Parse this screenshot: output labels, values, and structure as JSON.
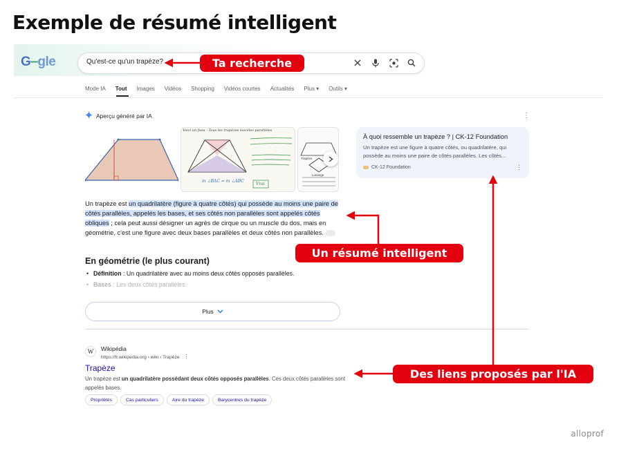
{
  "page_title": "Exemple de résumé intelligent",
  "google": {
    "logo_letters": [
      "G",
      "‒",
      "gle"
    ],
    "search_value": "Qu'est-ce qu'un trapèze?",
    "tabs": [
      {
        "label": "Mode IA"
      },
      {
        "label": "Tout"
      },
      {
        "label": "Images"
      },
      {
        "label": "Vidéos"
      },
      {
        "label": "Shopping"
      },
      {
        "label": "Vidéos courtes"
      },
      {
        "label": "Actualités"
      },
      {
        "label": "Plus"
      },
      {
        "label": "Outils"
      }
    ],
    "active_tab": "Tout"
  },
  "ai_overview": {
    "header": "Aperçu généré par IA",
    "image_texts": {
      "handwritten_line": "Voici un fusu : Tous les trapèzes isocèles parallèles",
      "formula": "m ∠BAC = m ∠ABC",
      "vrai": "Vrai",
      "diagram_label_1": "Trapèze",
      "diagram_label_2": "Losange"
    },
    "summary_intro": "Un trapèze est ",
    "summary_highlight": "un quadrilatère (figure à quatre côtés) qui possède au moins une paire de côtés parallèles, appelés les bases, et ses côtés non parallèles sont appelés côtés obliques",
    "summary_rest": " ; cela peut aussi désigner un agrès de cirque ou un muscle du dos, mais en géométrie, c'est une figure avec deux bases parallèles et deux côtés non parallèles.",
    "section_title": "En géométrie (le plus courant)",
    "bullets": [
      {
        "term": "Définition",
        "text": " : Un quadrilatère avec au moins deux côtés opposés parallèles."
      },
      {
        "term": "Bases",
        "text": " : Les deux côtés parallèles."
      }
    ],
    "more_button": "Plus"
  },
  "side_card": {
    "title": "À quoi ressemble un trapèze ? | CK-12 Foundation",
    "snippet": "Un trapèze est une figure à quatre côtés, ou quadrilatère, qui possède au moins une paire de côtés parallèles. Les côtés...",
    "source": "CK-12 Foundation"
  },
  "wiki_result": {
    "favicon": "W",
    "site": "Wikipédia",
    "url": "https://fr.wikipedia.org › wiki › Trapèze",
    "title": "Trapèze",
    "snippet_a": "Un trapèze est ",
    "snippet_b": "un quadrilatère possédant deux côtés opposés parallèles",
    "snippet_c": ". Ces deux côtés parallèles sont appelés bases.",
    "chips": [
      "Propriétés",
      "Cas particuliers",
      "Aire du trapèze",
      "Barycentres du trapèze"
    ]
  },
  "callouts": {
    "search": "Ta recherche",
    "summary": "Un résumé intelligent",
    "links": "Des liens proposés par l'IA"
  },
  "brand": "alloprof",
  "colors": {
    "callout_red": "#e3000f",
    "link_blue": "#1a0dab",
    "highlight": "#d3e3fd",
    "side_card_bg": "#eff3fb"
  }
}
